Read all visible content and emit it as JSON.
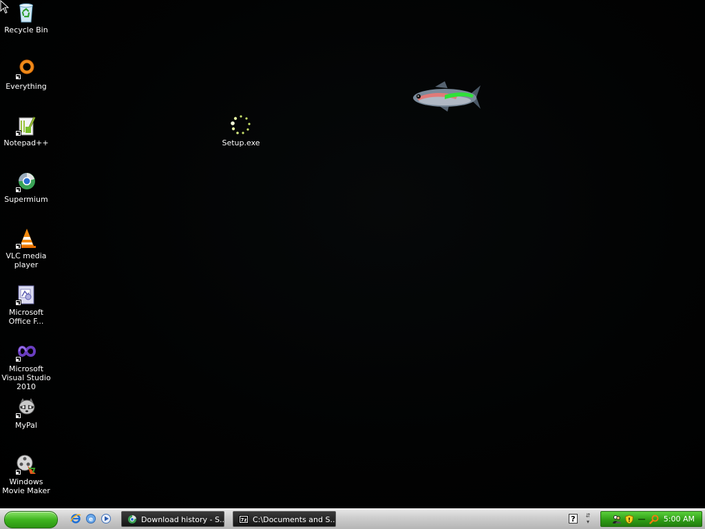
{
  "desktop": {
    "icons": [
      {
        "label": "Recycle Bin"
      },
      {
        "label": "Everything"
      },
      {
        "label": "Notepad++"
      },
      {
        "label": "Supermium"
      },
      {
        "label": "VLC media player"
      },
      {
        "label": "Microsoft Office F..."
      },
      {
        "label": "Microsoft Visual Studio 2010"
      },
      {
        "label": "MyPal"
      },
      {
        "label": "Windows Movie Maker"
      },
      {
        "label": "Setup.exe"
      }
    ]
  },
  "taskbar": {
    "tasks": [
      {
        "label": "Download history - S...",
        "icon": "supermium-icon"
      },
      {
        "label": "C:\\Documents and S...",
        "icon": "7zip-icon"
      }
    ],
    "tray": {
      "clock": "5:00 AM"
    }
  },
  "colors": {
    "start_green": "#3fb51f",
    "tray_green": "#2f9e16",
    "taskbar_silver": "#cfcfcf",
    "task_button": "#141414"
  }
}
